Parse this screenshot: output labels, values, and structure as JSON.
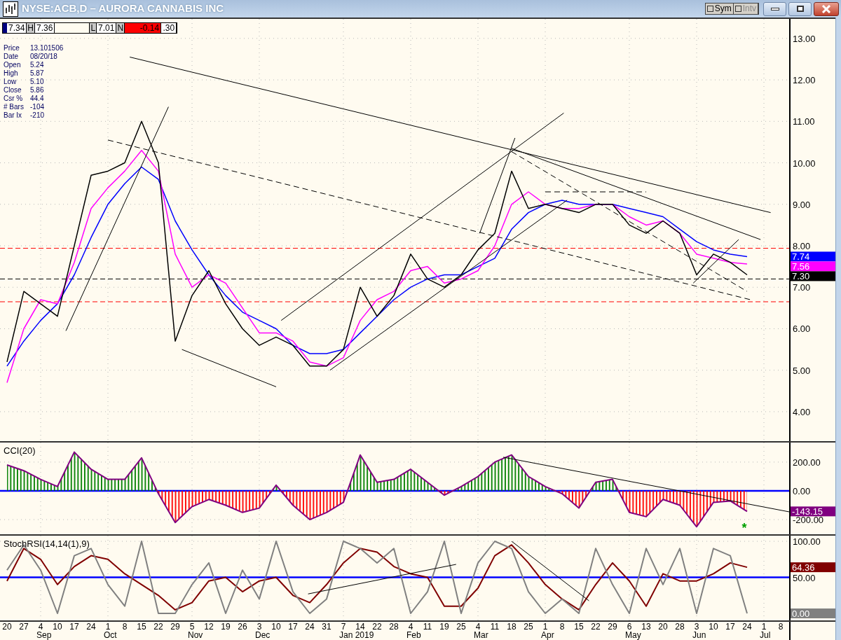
{
  "window": {
    "title": "NYSE:ACB,D – AURORA CANNABIS INC",
    "toggles": [
      {
        "label": "Sym",
        "checked": false,
        "disabled": false
      },
      {
        "label": "Intv",
        "checked": false,
        "disabled": true
      }
    ],
    "controls": [
      {
        "kind": "minimize"
      },
      {
        "kind": "maximize"
      },
      {
        "kind": "close"
      }
    ]
  },
  "quote_bar": [
    {
      "kind": "swatch",
      "color": "#00007f"
    },
    {
      "kind": "value",
      "text": "7.34"
    },
    {
      "kind": "tag",
      "text": "H"
    },
    {
      "kind": "value",
      "text": "7.36"
    },
    {
      "kind": "blank"
    },
    {
      "kind": "tag",
      "text": "L"
    },
    {
      "kind": "value",
      "text": "7.01"
    },
    {
      "kind": "tag",
      "text": "N"
    },
    {
      "kind": "alert",
      "text": "-0.14"
    },
    {
      "kind": "value",
      "text": ".30"
    }
  ],
  "info_panel": [
    {
      "label": "Price",
      "value": "13.101506"
    },
    {
      "label": "Date",
      "value": "08/20/18"
    },
    {
      "label": "Open",
      "value": "5.24"
    },
    {
      "label": "High",
      "value": "5.87"
    },
    {
      "label": "Low",
      "value": "5.10"
    },
    {
      "label": "Close",
      "value": "5.86"
    },
    {
      "label": "Csr %",
      "value": "44.4"
    },
    {
      "label": "# Bars",
      "value": "-104"
    },
    {
      "label": "Bar Ix",
      "value": "-210"
    }
  ],
  "price_chart": {
    "chart_data": {
      "type": "line",
      "grid": true,
      "series": [
        {
          "color": "#0000ff",
          "values": [
            5.1,
            5.7,
            6.2,
            6.6,
            7.3,
            8.2,
            9.0,
            9.5,
            9.9,
            9.6,
            8.6,
            7.9,
            7.3,
            6.8,
            6.4,
            6.2,
            6.0,
            5.6,
            5.4,
            5.4,
            5.5,
            5.9,
            6.3,
            6.7,
            7.0,
            7.2,
            7.3,
            7.3,
            7.5,
            7.7,
            8.4,
            8.8,
            9.0,
            9.1,
            9.0,
            9.0,
            9.0,
            8.9,
            8.8,
            8.7,
            8.4,
            8.1,
            7.9,
            7.8,
            7.74,
            null,
            null
          ]
        },
        {
          "color": "#ff00ff",
          "values": [
            4.7,
            6.0,
            6.7,
            6.6,
            7.6,
            8.9,
            9.4,
            9.8,
            10.3,
            9.8,
            7.8,
            7.0,
            7.3,
            7.1,
            6.5,
            5.9,
            5.9,
            5.7,
            5.2,
            5.1,
            5.3,
            6.2,
            6.7,
            6.9,
            7.4,
            7.5,
            7.1,
            7.2,
            7.4,
            8.0,
            9.0,
            9.3,
            9.0,
            8.9,
            8.9,
            9.0,
            9.0,
            8.7,
            8.5,
            8.6,
            8.3,
            7.8,
            7.7,
            7.6,
            7.56,
            null,
            null
          ]
        },
        {
          "color": "#000000",
          "values": [
            5.2,
            6.9,
            6.6,
            6.3,
            8.0,
            9.7,
            9.8,
            10.0,
            11.0,
            10.0,
            5.7,
            6.8,
            7.4,
            6.6,
            6.0,
            5.6,
            5.8,
            5.6,
            5.1,
            5.1,
            5.5,
            7.0,
            6.3,
            6.8,
            7.8,
            7.2,
            7.0,
            7.3,
            7.9,
            8.3,
            9.8,
            8.9,
            9.0,
            8.9,
            8.8,
            9.0,
            9.0,
            8.5,
            8.3,
            8.6,
            8.3,
            7.3,
            7.8,
            7.6,
            7.3,
            null,
            null
          ]
        }
      ],
      "ylim": [
        3.29,
        13.47
      ],
      "yticks": [
        {
          "value": 13,
          "label": "13.00"
        },
        {
          "value": 12,
          "label": "12.00"
        },
        {
          "value": 11,
          "label": "11.00"
        },
        {
          "value": 10,
          "label": "10.00"
        },
        {
          "value": 9,
          "label": "9.00"
        },
        {
          "value": 8,
          "label": "8.00"
        },
        {
          "value": 7,
          "label": "7.00"
        },
        {
          "value": 6,
          "label": "6.00"
        },
        {
          "value": 5,
          "label": "5.00"
        },
        {
          "value": 4,
          "label": "4.00"
        }
      ],
      "ref_lines": [
        {
          "axis": "y",
          "value": 7.94,
          "color": "#ff0000"
        },
        {
          "axis": "y",
          "value": 6.65,
          "color": "#ff0000"
        },
        {
          "axis": "y",
          "value": 7.2,
          "color": "#000000"
        }
      ]
    },
    "value_tags": [
      {
        "text": "7.74",
        "color": "#0000ff"
      },
      {
        "text": "7.56",
        "color": "#ff00ff"
      },
      {
        "text": "7.30",
        "color": "#000000"
      }
    ]
  },
  "cci_panel": {
    "chart_data": {
      "type": "area",
      "title": "CCI(20)",
      "grid": true,
      "series": [
        {
          "color": "#800080",
          "values": [
            180,
            140,
            80,
            30,
            270,
            150,
            80,
            80,
            230,
            -20,
            -220,
            -110,
            -60,
            -100,
            -150,
            -120,
            40,
            -100,
            -200,
            -150,
            -80,
            250,
            60,
            80,
            150,
            60,
            -30,
            30,
            100,
            200,
            250,
            100,
            30,
            -20,
            -120,
            60,
            80,
            -150,
            -180,
            -60,
            -100,
            -250,
            -80,
            -70,
            -143,
            null,
            null
          ]
        }
      ],
      "ylim": [
        -302,
        336
      ],
      "yticks": [
        {
          "value": 200,
          "label": "200.00"
        },
        {
          "value": 0,
          "label": "0.00"
        },
        {
          "value": -200,
          "label": "-200.00"
        }
      ],
      "ref_lines": [
        {
          "axis": "y",
          "value": 0,
          "color": "#0000ff"
        }
      ]
    },
    "value_tags": [
      {
        "text": "-143.15",
        "color": "#800080"
      }
    ],
    "marker": {
      "text": "*",
      "color": "#00a000"
    }
  },
  "stoch_panel": {
    "chart_data": {
      "type": "line",
      "title": "StochRSI(14,14(1),9)",
      "grid": true,
      "series": [
        {
          "color": "#800000",
          "values": [
            45,
            90,
            75,
            40,
            65,
            80,
            75,
            55,
            40,
            25,
            5,
            15,
            45,
            50,
            30,
            45,
            50,
            25,
            15,
            40,
            70,
            90,
            85,
            65,
            55,
            50,
            10,
            10,
            35,
            80,
            95,
            70,
            40,
            20,
            5,
            40,
            70,
            45,
            10,
            55,
            45,
            45,
            55,
            70,
            64,
            null,
            null
          ]
        },
        {
          "color": "#808080",
          "values": [
            60,
            95,
            60,
            0,
            80,
            90,
            40,
            10,
            100,
            0,
            0,
            40,
            70,
            0,
            60,
            20,
            100,
            30,
            0,
            20,
            100,
            90,
            70,
            90,
            0,
            30,
            100,
            0,
            70,
            100,
            90,
            30,
            0,
            20,
            0,
            90,
            40,
            0,
            90,
            40,
            90,
            0,
            90,
            80,
            0,
            null,
            null
          ]
        }
      ],
      "ylim": [
        -9.7,
        107.8
      ],
      "yticks": [
        {
          "value": 100,
          "label": "100.00"
        },
        {
          "value": 50,
          "label": "50.00"
        }
      ],
      "ref_lines": [
        {
          "axis": "y",
          "value": 50,
          "color": "#0000ff"
        }
      ]
    },
    "value_tags": [
      {
        "text": "64.36",
        "color": "#800000"
      },
      {
        "text": "0.00",
        "color": "#808080"
      }
    ]
  },
  "date_axis": [
    {
      "day": "20"
    },
    {
      "day": "27"
    },
    {
      "day": "4",
      "month": "Sep"
    },
    {
      "day": "10"
    },
    {
      "day": "17"
    },
    {
      "day": "24"
    },
    {
      "day": "1",
      "month": "Oct"
    },
    {
      "day": "8"
    },
    {
      "day": "15"
    },
    {
      "day": "22"
    },
    {
      "day": "29"
    },
    {
      "day": "5",
      "month": "Nov"
    },
    {
      "day": "12"
    },
    {
      "day": "19"
    },
    {
      "day": "26"
    },
    {
      "day": "3",
      "month": "Dec"
    },
    {
      "day": "10"
    },
    {
      "day": "17"
    },
    {
      "day": "24"
    },
    {
      "day": "31"
    },
    {
      "day": "7",
      "month": "Jan 2019"
    },
    {
      "day": "14"
    },
    {
      "day": "22"
    },
    {
      "day": "28"
    },
    {
      "day": "4",
      "month": "Feb"
    },
    {
      "day": "11"
    },
    {
      "day": "19"
    },
    {
      "day": "25"
    },
    {
      "day": "4",
      "month": "Mar"
    },
    {
      "day": "11"
    },
    {
      "day": "18"
    },
    {
      "day": "25"
    },
    {
      "day": "1",
      "month": "Apr"
    },
    {
      "day": "8"
    },
    {
      "day": "15"
    },
    {
      "day": "22"
    },
    {
      "day": "29"
    },
    {
      "day": "6",
      "month": "May"
    },
    {
      "day": "13"
    },
    {
      "day": "20"
    },
    {
      "day": "28"
    },
    {
      "day": "3",
      "month": "Jun"
    },
    {
      "day": "10"
    },
    {
      "day": "17"
    },
    {
      "day": "24"
    },
    {
      "day": "1",
      "month": "Jul"
    },
    {
      "day": "8"
    }
  ]
}
